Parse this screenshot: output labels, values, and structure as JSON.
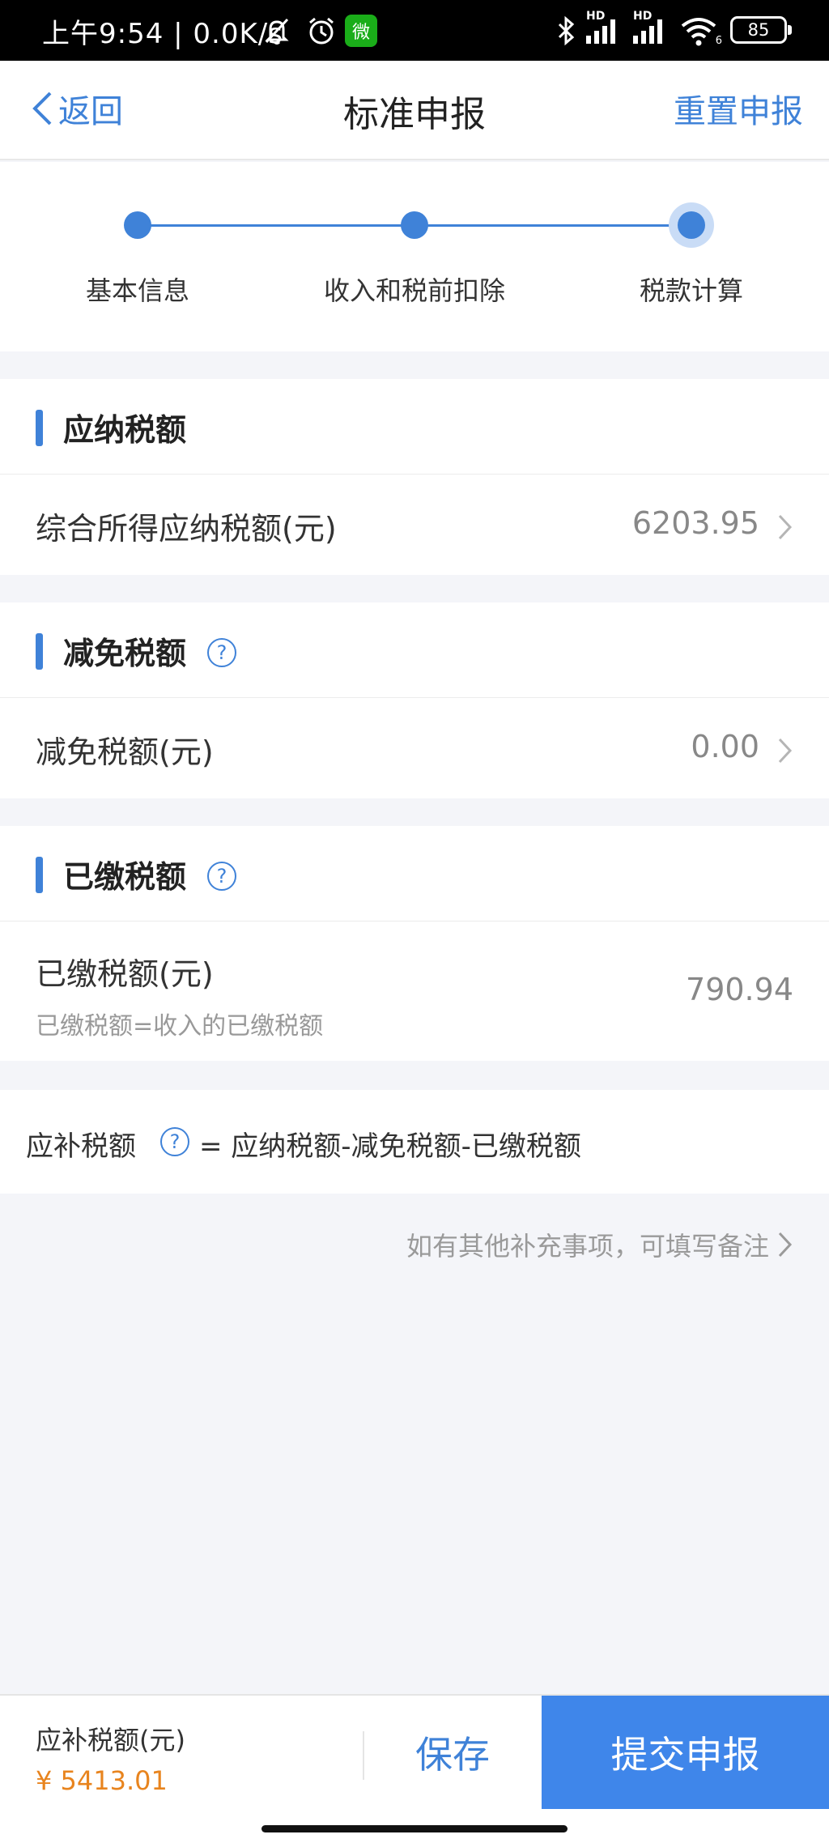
{
  "status": {
    "time": "上午9:54 | 0.0K/s",
    "battery": "85",
    "hd1": "HD",
    "hd2": "HD",
    "wifi_sub": "6"
  },
  "nav": {
    "back_label": "返回",
    "title": "标准申报",
    "reset_label": "重置申报"
  },
  "steps": [
    {
      "label": "基本信息"
    },
    {
      "label": "收入和税前扣除"
    },
    {
      "label": "税款计算"
    }
  ],
  "sections": {
    "payable": {
      "title": "应纳税额",
      "row_label": "综合所得应纳税额(元)",
      "row_value": "6203.95"
    },
    "reduction": {
      "title": "减免税额",
      "row_label": "减免税额(元)",
      "row_value": "0.00"
    },
    "paid": {
      "title": "已缴税额",
      "row_label": "已缴税额(元)",
      "row_sub": "已缴税额=收入的已缴税额",
      "row_value": "790.94"
    }
  },
  "formula": {
    "label": "应补税额",
    "expression": "= 应纳税额-减免税额-已缴税额"
  },
  "remark": {
    "text": "如有其他补充事项，可填写备注"
  },
  "bottom": {
    "amount_label": "应补税额(元)",
    "amount_value": "¥ 5413.01",
    "save_label": "保存",
    "submit_label": "提交申报"
  },
  "icons": {
    "qmark": "?",
    "wechat": "微"
  },
  "colors": {
    "accent": "#3f82d8",
    "submit_bg": "#3f86ea",
    "amount": "#e8841e"
  }
}
